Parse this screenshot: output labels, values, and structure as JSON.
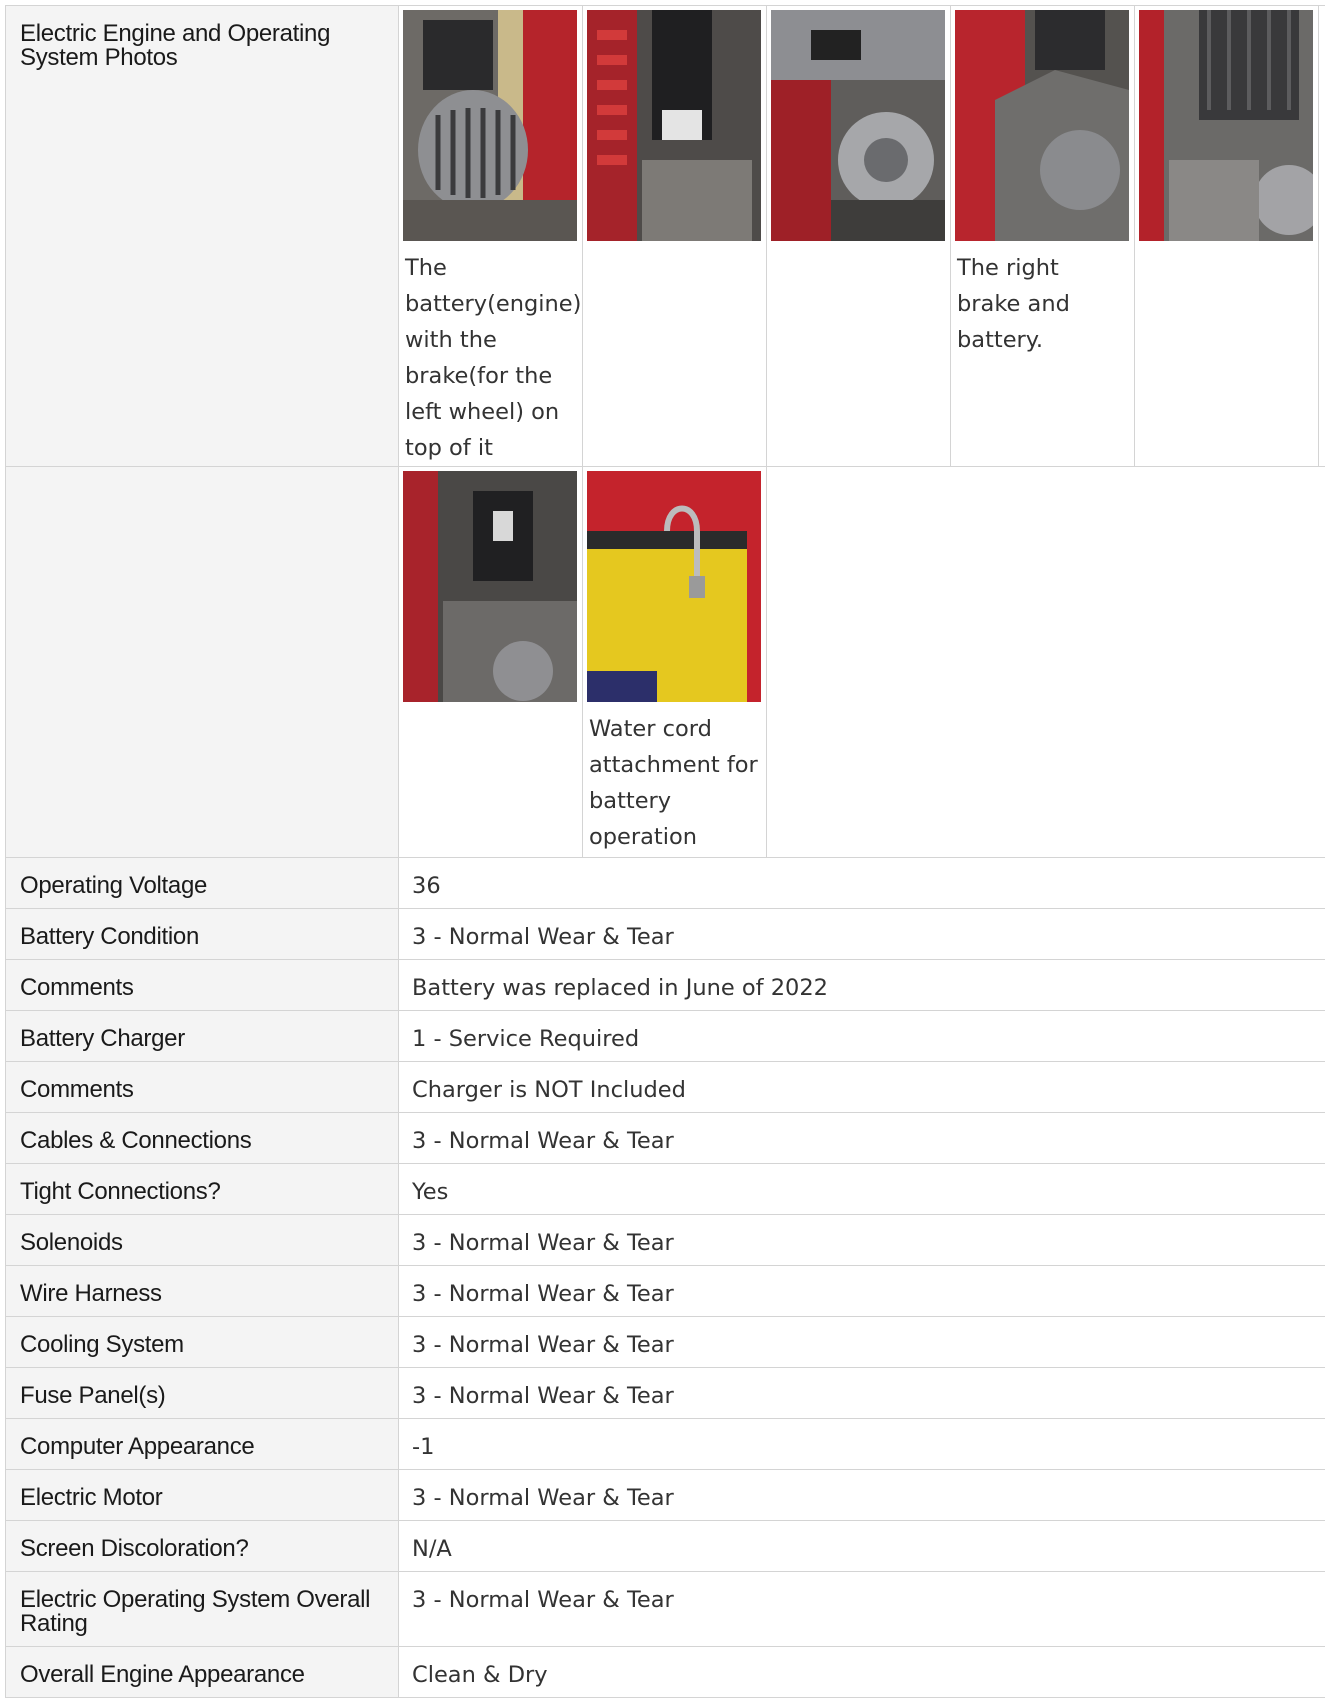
{
  "section_title": "Electric Engine and Operating System Photos",
  "photos": [
    {
      "alt": "engine-photo",
      "caption": "The battery(engine) with the brake(for the left wheel) on top of it"
    },
    {
      "alt": "engine-photo",
      "caption": ""
    },
    {
      "alt": "engine-photo",
      "caption": ""
    },
    {
      "alt": "engine-photo",
      "caption": "The right brake and battery."
    },
    {
      "alt": "engine-photo",
      "caption": ""
    },
    {
      "alt": "engine-photo",
      "caption": ""
    },
    {
      "alt": "battery-photo",
      "caption": "Water cord attachment for battery operation"
    }
  ],
  "rows": [
    {
      "label": "Operating Voltage",
      "value": "36"
    },
    {
      "label": "Battery Condition",
      "value": "3 - Normal Wear & Tear"
    },
    {
      "label": "Comments",
      "value": "Battery was replaced in June of 2022"
    },
    {
      "label": "Battery Charger",
      "value": "1 - Service Required"
    },
    {
      "label": "Comments",
      "value": "Charger is NOT Included"
    },
    {
      "label": "Cables & Connections",
      "value": "3 - Normal Wear & Tear"
    },
    {
      "label": "Tight Connections?",
      "value": "Yes"
    },
    {
      "label": "Solenoids",
      "value": "3 - Normal Wear & Tear"
    },
    {
      "label": "Wire Harness",
      "value": "3 - Normal Wear & Tear"
    },
    {
      "label": "Cooling System",
      "value": "3 - Normal Wear & Tear"
    },
    {
      "label": "Fuse Panel(s)",
      "value": "3 - Normal Wear & Tear"
    },
    {
      "label": "Computer Appearance",
      "value": "-1"
    },
    {
      "label": "Electric Motor",
      "value": "3 - Normal Wear & Tear"
    },
    {
      "label": "Screen Discoloration?",
      "value": "N/A"
    },
    {
      "label": "Electric Operating System Overall Rating",
      "value": "3 - Normal Wear & Tear"
    },
    {
      "label": "Overall Engine Appearance",
      "value": "Clean & Dry"
    }
  ]
}
